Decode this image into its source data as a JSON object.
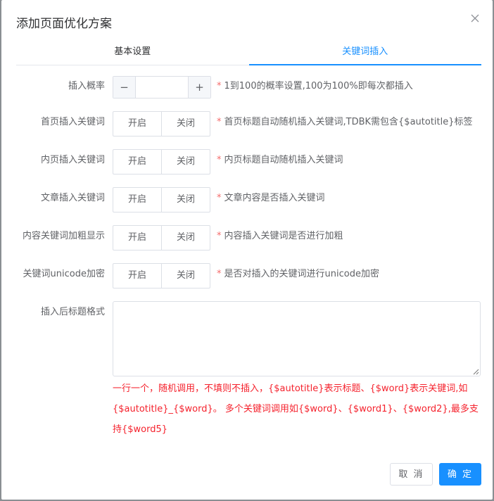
{
  "dialog": {
    "title": "添加页面优化方案"
  },
  "tabs": [
    {
      "label": "基本设置",
      "active": false
    },
    {
      "label": "关键词插入",
      "active": true
    }
  ],
  "form": {
    "probability": {
      "label": "插入概率",
      "value": "",
      "minus": "−",
      "plus": "+",
      "hint": "1到100的概率设置,100为100%即每次都插入"
    },
    "rows": [
      {
        "label": "首页插入关键词",
        "on": "开启",
        "off": "关闭",
        "hint": "首页标题自动随机插入关键词,TDBK需包含{$autotitle}标签"
      },
      {
        "label": "内页插入关键词",
        "on": "开启",
        "off": "关闭",
        "hint": "内页标题自动随机插入关键词"
      },
      {
        "label": "文章插入关键词",
        "on": "开启",
        "off": "关闭",
        "hint": "文章内容是否插入关键词"
      },
      {
        "label": "内容关键词加粗显示",
        "on": "开启",
        "off": "关闭",
        "hint": "内容插入关键词是否进行加粗"
      },
      {
        "label": "关键词unicode加密",
        "on": "开启",
        "off": "关闭",
        "hint": "是否对插入的关键词进行unicode加密"
      }
    ],
    "title_format": {
      "label": "插入后标题格式",
      "value": "",
      "help": "一行一个，随机调用，不填则不插入，{$autotitle}表示标题、{$word}表示关键词,如{$autotitle}_{$word}。 多个关键词调用如{$word}、{$word1}、{$word2},最多支持{$word5}"
    },
    "required_mark": "*"
  },
  "footer": {
    "cancel": "取 消",
    "confirm": "确 定"
  },
  "colors": {
    "accent": "#1890ff",
    "danger": "#f5222d",
    "star": "#f56c6c"
  }
}
